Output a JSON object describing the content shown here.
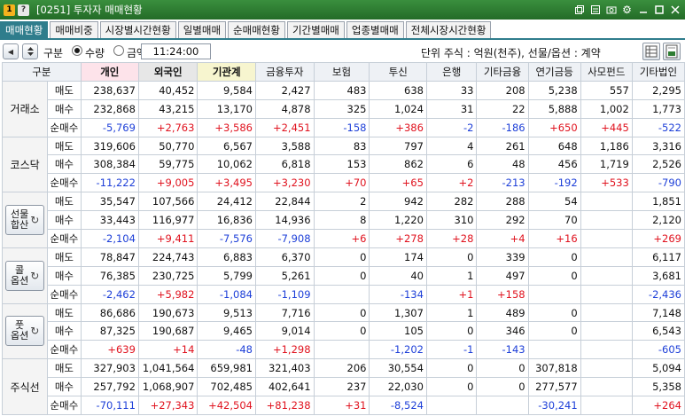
{
  "window": {
    "badges": [
      "1",
      "?"
    ],
    "title": "[0251] 투자자 매매현황"
  },
  "tabs": [
    {
      "label": "매매현황",
      "active": true
    },
    {
      "label": "매매비중",
      "active": false
    },
    {
      "label": "시장별시간현황",
      "active": false
    },
    {
      "label": "일별매매",
      "active": false
    },
    {
      "label": "순매매현황",
      "active": false
    },
    {
      "label": "기간별매매",
      "active": false
    },
    {
      "label": "업종별매매",
      "active": false
    },
    {
      "label": "전체시장시간현황",
      "active": false
    }
  ],
  "controls": {
    "label": "구분",
    "options": [
      "수량",
      "금액"
    ],
    "selected": "수량",
    "time": "11:24:00",
    "unit_text": "단위 주식 : 억원(천주), 선물/옵션 : 계약"
  },
  "table": {
    "headers": [
      "구분",
      "개인",
      "외국인",
      "기관계",
      "금융투자",
      "보험",
      "투신",
      "은행",
      "기타금융",
      "연기금등",
      "사모펀드",
      "기타법인"
    ],
    "groups": [
      {
        "market": "거래소",
        "button": false,
        "rows": [
          {
            "label": "매도",
            "values": [
              "238,637",
              "40,452",
              "9,584",
              "2,427",
              "483",
              "638",
              "33",
              "208",
              "5,238",
              "557",
              "2,295"
            ]
          },
          {
            "label": "매수",
            "values": [
              "232,868",
              "43,215",
              "13,170",
              "4,878",
              "325",
              "1,024",
              "31",
              "22",
              "5,888",
              "1,002",
              "1,773"
            ]
          },
          {
            "label": "순매수",
            "values": [
              "-5,769",
              "+2,763",
              "+3,586",
              "+2,451",
              "-158",
              "+386",
              "-2",
              "-186",
              "+650",
              "+445",
              "-522"
            ]
          }
        ]
      },
      {
        "market": "코스닥",
        "button": false,
        "rows": [
          {
            "label": "매도",
            "values": [
              "319,606",
              "50,770",
              "6,567",
              "3,588",
              "83",
              "797",
              "4",
              "261",
              "648",
              "1,186",
              "3,316"
            ]
          },
          {
            "label": "매수",
            "values": [
              "308,384",
              "59,775",
              "10,062",
              "6,818",
              "153",
              "862",
              "6",
              "48",
              "456",
              "1,719",
              "2,526"
            ]
          },
          {
            "label": "순매수",
            "values": [
              "-11,222",
              "+9,005",
              "+3,495",
              "+3,230",
              "+70",
              "+65",
              "+2",
              "-213",
              "-192",
              "+533",
              "-790"
            ]
          }
        ]
      },
      {
        "market": [
          "선물",
          "합산"
        ],
        "button": true,
        "rows": [
          {
            "label": "매도",
            "values": [
              "35,547",
              "107,566",
              "24,412",
              "22,844",
              "2",
              "942",
              "282",
              "288",
              "54",
              "",
              "1,851"
            ]
          },
          {
            "label": "매수",
            "values": [
              "33,443",
              "116,977",
              "16,836",
              "14,936",
              "8",
              "1,220",
              "310",
              "292",
              "70",
              "",
              "2,120"
            ]
          },
          {
            "label": "순매수",
            "values": [
              "-2,104",
              "+9,411",
              "-7,576",
              "-7,908",
              "+6",
              "+278",
              "+28",
              "+4",
              "+16",
              "",
              "+269"
            ]
          }
        ]
      },
      {
        "market": [
          "콜",
          "옵션"
        ],
        "button": true,
        "rows": [
          {
            "label": "매도",
            "values": [
              "78,847",
              "224,743",
              "6,883",
              "6,370",
              "0",
              "174",
              "0",
              "339",
              "0",
              "",
              "6,117"
            ]
          },
          {
            "label": "매수",
            "values": [
              "76,385",
              "230,725",
              "5,799",
              "5,261",
              "0",
              "40",
              "1",
              "497",
              "0",
              "",
              "3,681"
            ]
          },
          {
            "label": "순매수",
            "values": [
              "-2,462",
              "+5,982",
              "-1,084",
              "-1,109",
              "",
              "-134",
              "+1",
              "+158",
              "",
              "",
              "-2,436"
            ]
          }
        ]
      },
      {
        "market": [
          "풋",
          "옵션"
        ],
        "button": true,
        "rows": [
          {
            "label": "매도",
            "values": [
              "86,686",
              "190,673",
              "9,513",
              "7,716",
              "0",
              "1,307",
              "1",
              "489",
              "0",
              "",
              "7,148"
            ]
          },
          {
            "label": "매수",
            "values": [
              "87,325",
              "190,687",
              "9,465",
              "9,014",
              "0",
              "105",
              "0",
              "346",
              "0",
              "",
              "6,543"
            ]
          },
          {
            "label": "순매수",
            "values": [
              "+639",
              "+14",
              "-48",
              "+1,298",
              "",
              "-1,202",
              "-1",
              "-143",
              "",
              "",
              "-605"
            ]
          }
        ]
      },
      {
        "market": "주식선",
        "button": false,
        "rows": [
          {
            "label": "매도",
            "values": [
              "327,903",
              "1,041,564",
              "659,981",
              "321,403",
              "206",
              "30,554",
              "0",
              "0",
              "307,818",
              "",
              "5,094"
            ]
          },
          {
            "label": "매수",
            "values": [
              "257,792",
              "1,068,907",
              "702,485",
              "402,641",
              "237",
              "22,030",
              "0",
              "0",
              "277,577",
              "",
              "5,358"
            ]
          },
          {
            "label": "순매수",
            "values": [
              "-70,111",
              "+27,343",
              "+42,504",
              "+81,238",
              "+31",
              "-8,524",
              "",
              "",
              "-30,241",
              "",
              "+264"
            ]
          }
        ]
      }
    ]
  },
  "colors": {
    "titlebar": "#2e7d32",
    "tab_active": "#2f7d8c",
    "positive": "#e0121e",
    "negative": "#1d3fd8"
  },
  "icons": [
    "restore-icon",
    "copy-icon",
    "camera-icon",
    "settings-icon",
    "minimize-icon",
    "maximize-icon",
    "close-icon",
    "prev-icon",
    "next-icon",
    "refresh-icon",
    "table-view-icon",
    "excel-icon"
  ]
}
